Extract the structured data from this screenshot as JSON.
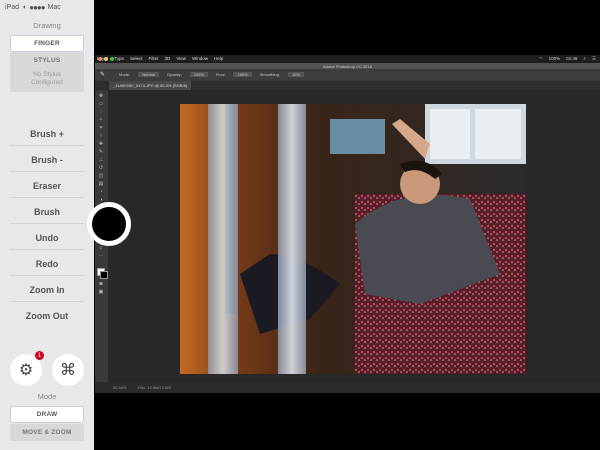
{
  "status_bar": {
    "device": "iPad",
    "network": "Mac"
  },
  "left_panel": {
    "drawing_label": "Drawing",
    "finger_label": "FINGER",
    "stylus_label": "STYLUS",
    "no_stylus_line1": "No Stylus",
    "no_stylus_line2": "Configured",
    "commands": [
      "Brush +",
      "Brush -",
      "Eraser",
      "Brush",
      "Undo",
      "Redo",
      "Zoom In",
      "Zoom Out"
    ],
    "settings_badge": "1",
    "mode_label": "Mode",
    "draw_label": "DRAW",
    "move_zoom_label": "MOVE & ZOOM"
  },
  "photoshop": {
    "menu": [
      "Layer",
      "Type",
      "Select",
      "Filter",
      "3D",
      "View",
      "Window",
      "Help"
    ],
    "clock": "02:48",
    "battery": "100%",
    "title": "Adobe Photoshop CC 2018",
    "options": {
      "mode_label": "Mode:",
      "mode_value": "Normal",
      "opacity_label": "Opacity:",
      "opacity_value": "100%",
      "flow_label": "Flow:",
      "flow_value": "100%",
      "smoothing_label": "Smoothing:",
      "smoothing_value": "10%"
    },
    "document_tab": "_11A5095C_0474.JPG @ 50.3% (RGB/8)",
    "zoom_level": "50.44%",
    "doc_info": "Doc: 12.6M/12.6M"
  },
  "colors": {
    "panel_bg": "#e8e8ea",
    "badge": "#d0021b",
    "ps_dark": "#282828"
  }
}
